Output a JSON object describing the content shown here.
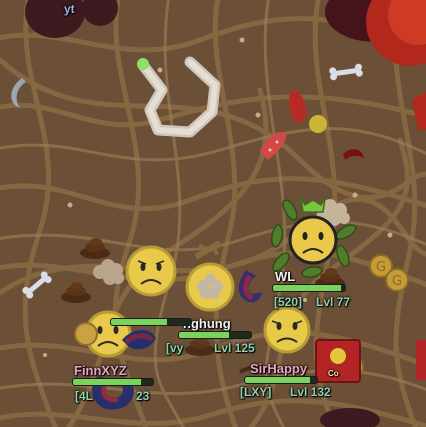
{
  "game": {
    "background_color": "#6b5037",
    "vein_color": "#8a6c45",
    "players": [
      {
        "name": "WL",
        "clan": "[520]",
        "level_text": "Lvl 77",
        "health": 0.95
      },
      {
        "name": "nghung",
        "clan": "[vy",
        "level_text": "Lvl 125",
        "health": 0.7
      },
      {
        "name": "FinnXYZ",
        "clan": "[4L",
        "level_text": "23",
        "health": 0.85
      },
      {
        "name": "SirHappy",
        "clan": "[LXY]",
        "level_text": "Lvl 132",
        "health": 0.9
      }
    ],
    "top_fragment": "yt",
    "card_text": "Co"
  }
}
